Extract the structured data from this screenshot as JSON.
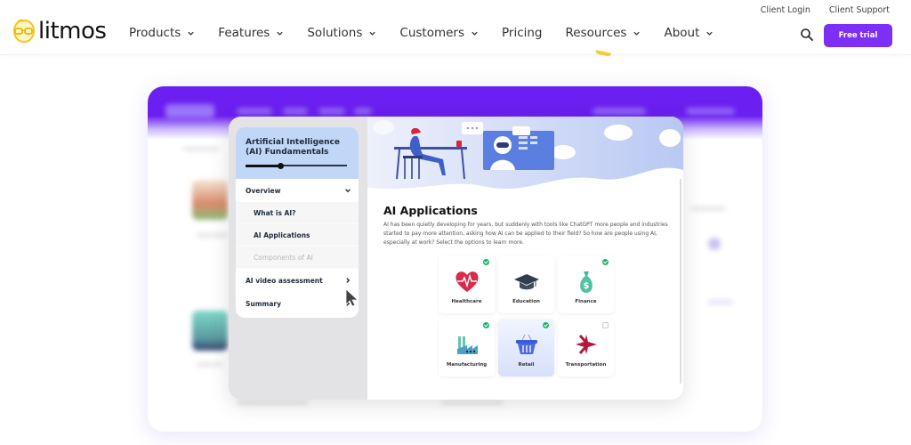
{
  "header": {
    "brand": "litmos",
    "nav": [
      {
        "label": "Products",
        "has_dropdown": true
      },
      {
        "label": "Features",
        "has_dropdown": true
      },
      {
        "label": "Solutions",
        "has_dropdown": true
      },
      {
        "label": "Customers",
        "has_dropdown": true
      },
      {
        "label": "Pricing",
        "has_dropdown": false
      },
      {
        "label": "Resources",
        "has_dropdown": true
      },
      {
        "label": "About",
        "has_dropdown": true
      }
    ],
    "utility_links": [
      "Client Login",
      "Client Support"
    ],
    "search_icon": "search-icon",
    "cta_label": "Free trial",
    "colors": {
      "brand_purple": "#7b2ff7",
      "logo_yellow": "#f5c518"
    }
  },
  "course": {
    "title": "Artificial Intelligence (AI) Fundamentals",
    "progress_fraction": 0.35,
    "menu": [
      {
        "label": "Overview",
        "type": "section",
        "state": "expanded",
        "icon": "chevron-down-icon"
      },
      {
        "label": "What is AI?",
        "type": "sub",
        "state": "done"
      },
      {
        "label": "AI Applications",
        "type": "sub",
        "state": "current"
      },
      {
        "label": "Components of AI",
        "type": "sub",
        "state": "locked"
      },
      {
        "label": "AI video assessment",
        "type": "section",
        "icon": "chevron-right-icon"
      },
      {
        "label": "Summary",
        "type": "section",
        "icon": "chevron-right-icon"
      }
    ]
  },
  "lesson": {
    "title": "AI Applications",
    "body": "AI has been quietly developing for years, but suddenly with tools like ChatGPT more people and industries started to pay more attention, asking how AI can be applied to their field? So how are people using AI, especially at work? Select the options to learn more.",
    "tiles": [
      {
        "label": "Healthcare",
        "icon": "heart-pulse-icon",
        "status": "complete",
        "selected": false
      },
      {
        "label": "Education",
        "icon": "graduation-cap-icon",
        "status": "none",
        "selected": false
      },
      {
        "label": "Finance",
        "icon": "money-bag-icon",
        "status": "complete",
        "selected": false
      },
      {
        "label": "Manufacturing",
        "icon": "factory-icon",
        "status": "complete",
        "selected": false
      },
      {
        "label": "Retail",
        "icon": "shopping-basket-icon",
        "status": "complete",
        "selected": true
      },
      {
        "label": "Transportation",
        "icon": "airplane-icon",
        "status": "pending",
        "selected": false
      }
    ]
  }
}
